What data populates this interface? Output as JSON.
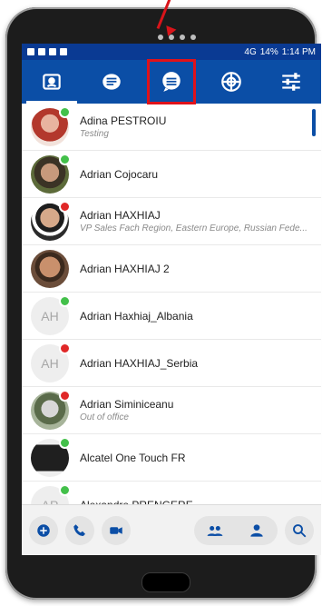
{
  "status": {
    "network": "4G",
    "battery": "14%",
    "time": "1:14 PM"
  },
  "tabs": [
    {
      "icon": "contacts-icon"
    },
    {
      "icon": "chat-list-icon"
    },
    {
      "icon": "conversation-bubble-icon"
    },
    {
      "icon": "bubbles-network-icon"
    },
    {
      "icon": "settings-sliders-icon"
    }
  ],
  "contacts": [
    {
      "name": "Adina PESTROIU",
      "subtitle": "Testing",
      "presence": "#43c04a",
      "initials": ""
    },
    {
      "name": "Adrian Cojocaru",
      "subtitle": "",
      "presence": "#43c04a",
      "initials": ""
    },
    {
      "name": "Adrian HAXHIAJ",
      "subtitle": "VP Sales Fach Region, Eastern Europe, Russian Fede...",
      "presence": "#e02828",
      "initials": ""
    },
    {
      "name": "Adrian HAXHIAJ 2",
      "subtitle": "",
      "presence": "",
      "initials": ""
    },
    {
      "name": "Adrian Haxhiaj_Albania",
      "subtitle": "",
      "presence": "#43c04a",
      "initials": "AH"
    },
    {
      "name": "Adrian HAXHIAJ_Serbia",
      "subtitle": "",
      "presence": "#e02828",
      "initials": "AH"
    },
    {
      "name": "Adrian Siminiceanu",
      "subtitle": "Out of office",
      "presence": "#e02828",
      "initials": ""
    },
    {
      "name": "Alcatel One Touch FR",
      "subtitle": "",
      "presence": "#43c04a",
      "initials": ""
    },
    {
      "name": "Alexandre PRENGERE",
      "subtitle": "",
      "presence": "#43c04a",
      "initials": "AP"
    }
  ],
  "colors": {
    "primary": "#0b4ea6",
    "status_bar": "#0a3a93",
    "online": "#43c04a",
    "busy": "#e02828",
    "highlight": "#e0121a"
  }
}
